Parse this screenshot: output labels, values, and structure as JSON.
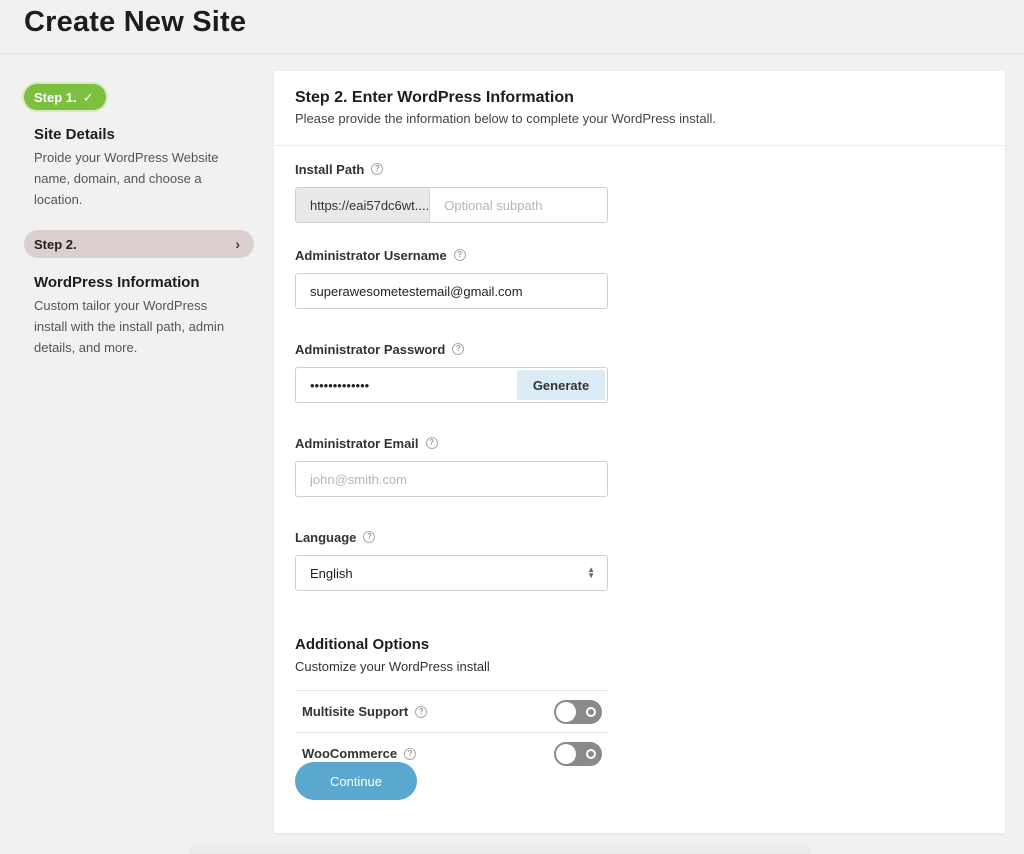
{
  "page": {
    "title": "Create New Site"
  },
  "sidebar": {
    "step1": {
      "pill": "Step 1.",
      "heading": "Site Details",
      "description": "Proide your WordPress Website name, domain, and choose a location."
    },
    "step2": {
      "pill": "Step 2.",
      "heading": "WordPress Information",
      "description": "Custom tailor your WordPress install with the install path, admin details, and more."
    }
  },
  "card": {
    "title": "Step 2. Enter WordPress Information",
    "subtitle": "Please provide the information below to complete your WordPress install."
  },
  "form": {
    "install_path": {
      "label": "Install Path",
      "prefix": "https://eai57dc6wt....",
      "placeholder": "Optional subpath"
    },
    "admin_username": {
      "label": "Administrator Username",
      "value": "superawesometestemail@gmail.com"
    },
    "admin_password": {
      "label": "Administrator Password",
      "value": "•••••••••••••",
      "generate_label": "Generate"
    },
    "admin_email": {
      "label": "Administrator Email",
      "placeholder": "john@smith.com"
    },
    "language": {
      "label": "Language",
      "value": "English"
    }
  },
  "additional_options": {
    "title": "Additional Options",
    "subtitle": "Customize your WordPress install",
    "options": [
      {
        "label": "Multisite Support",
        "enabled": false
      },
      {
        "label": "WooCommerce",
        "enabled": false
      }
    ]
  },
  "continue_label": "Continue",
  "colors": {
    "step_done": "#7dbf3f",
    "step_current": "#dccfd0",
    "generate_bg": "#dbecf7",
    "continue_bg": "#5aa8ce",
    "toggle_off": "#8a8a8a"
  },
  "icons": {
    "check": "check-icon",
    "chevron": "chevron-right-icon",
    "help": "help-icon",
    "select": "select-arrows-icon"
  }
}
